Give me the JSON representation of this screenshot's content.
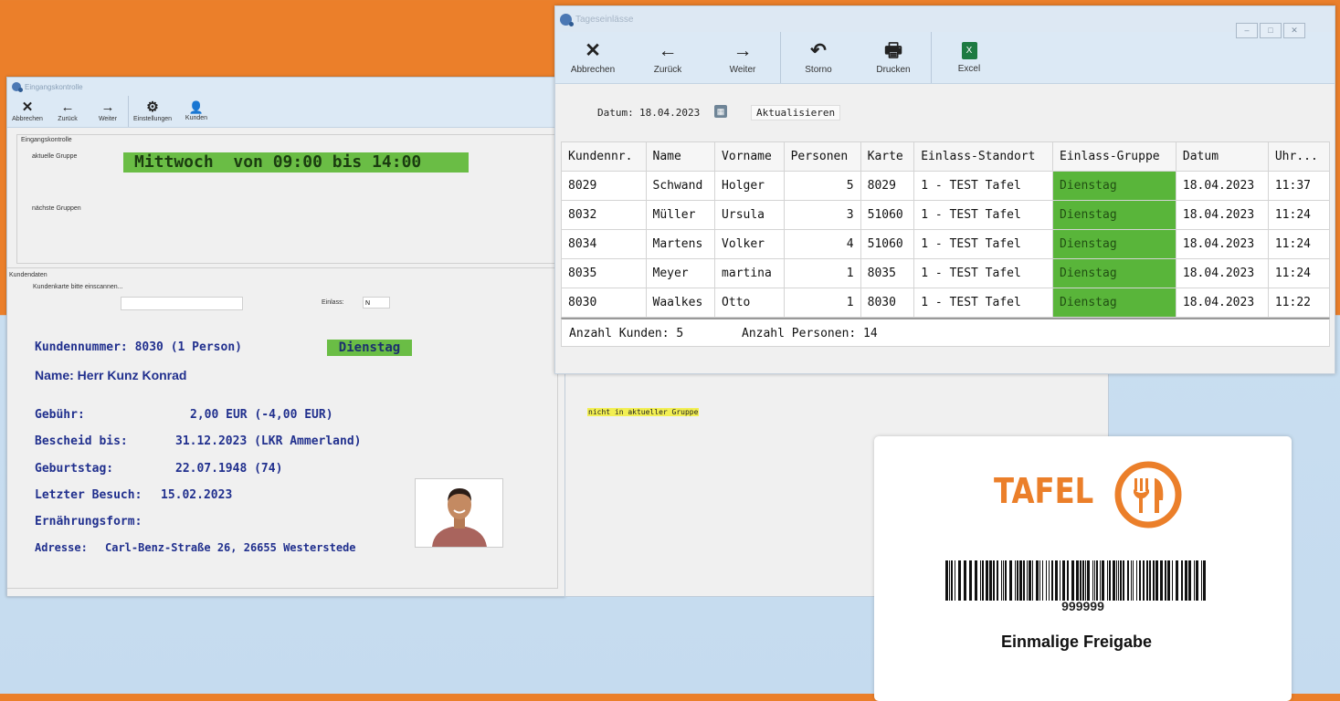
{
  "left_window": {
    "title": "Eingangskontrolle",
    "toolbar": [
      {
        "label": "Abbrechen",
        "icon": "close-icon",
        "glyph": "✕"
      },
      {
        "label": "Zurück",
        "icon": "arrow-left-icon",
        "glyph": "←"
      },
      {
        "label": "Weiter",
        "icon": "arrow-right-icon",
        "glyph": "→"
      },
      {
        "label": "Einstellungen",
        "icon": "gear-icon",
        "glyph": "⚙"
      },
      {
        "label": "Kunden",
        "icon": "user-icon",
        "glyph": "👤"
      }
    ],
    "eingang": {
      "group_label": "Eingangskontrolle",
      "current_label": "aktuelle Gruppe",
      "current_value": "Mittwoch  von 09:00 bis 14:00",
      "next_label": "nächste Gruppen"
    },
    "kunden": {
      "group_label": "Kundendaten",
      "scan_label": "Kundenkarte bitte einscannen...",
      "scan_value": "",
      "einlass_label": "Einlass:",
      "einlass_value": "N",
      "kundennummer": "Kundennummer: 8030 (1 Person)",
      "gruppe_badge": "Dienstag",
      "name": "Name: Herr Kunz Konrad",
      "gebuehr_label": "Gebühr:",
      "gebuehr_value": "2,00 EUR (-4,00 EUR)",
      "bescheid_label": "Bescheid bis:",
      "bescheid_value": "31.12.2023 (LKR Ammerland)",
      "geburtstag_label": "Geburtstag:",
      "geburtstag_value": "22.07.1948 (74)",
      "letzter_label": "Letzter Besuch:",
      "letzter_value": "15.02.2023",
      "ernaehrung_label": "Ernährungsform:",
      "adresse_label": "Adresse:",
      "adresse_value": "Carl-Benz-Straße 26, 26655 Westerstede",
      "warning": "nicht in aktueller Gruppe"
    }
  },
  "right_window": {
    "title": "Tageseinlässe",
    "toolbar": [
      {
        "label": "Abbrechen",
        "icon": "close-icon",
        "glyph": "✕"
      },
      {
        "label": "Zurück",
        "icon": "arrow-left-icon",
        "glyph": "←"
      },
      {
        "label": "Weiter",
        "icon": "arrow-right-icon",
        "glyph": "→"
      },
      {
        "label": "Storno",
        "icon": "undo-icon",
        "glyph": "↶"
      },
      {
        "label": "Drucken",
        "icon": "printer-icon",
        "glyph": "🖶"
      },
      {
        "label": "Excel",
        "icon": "excel-icon",
        "glyph": "X"
      }
    ],
    "datum_label": "Datum:",
    "datum_value": "18.04.2023",
    "refresh_label": "Aktualisieren",
    "columns": [
      "Kundennr.",
      "Name",
      "Vorname",
      "Personen",
      "Karte",
      "Einlass-Standort",
      "Einlass-Gruppe",
      "Datum",
      "Uhr..."
    ],
    "rows": [
      [
        "8029",
        "Schwand",
        "Holger",
        "5",
        "8029",
        "1 - TEST Tafel",
        "Dienstag",
        "18.04.2023",
        "11:37"
      ],
      [
        "8032",
        "Müller",
        "Ursula",
        "3",
        "51060",
        "1 - TEST Tafel",
        "Dienstag",
        "18.04.2023",
        "11:24"
      ],
      [
        "8034",
        "Martens",
        "Volker",
        "4",
        "51060",
        "1 - TEST Tafel",
        "Dienstag",
        "18.04.2023",
        "11:24"
      ],
      [
        "8035",
        "Meyer",
        "martina",
        "1",
        "8035",
        "1 - TEST Tafel",
        "Dienstag",
        "18.04.2023",
        "11:24"
      ],
      [
        "8030",
        "Waalkes",
        "Otto",
        "1",
        "8030",
        "1 - TEST Tafel",
        "Dienstag",
        "18.04.2023",
        "11:22"
      ]
    ],
    "summary_kunden": "Anzahl Kunden: 5",
    "summary_personen": "Anzahl Personen: 14"
  },
  "card": {
    "brand": "TAFEL",
    "barcode_number": "999999",
    "caption": "Einmalige Freigabe"
  },
  "colors": {
    "brand_orange": "#eb7f2a",
    "group_green": "#59b53a",
    "text_darkblue": "#21308e"
  }
}
